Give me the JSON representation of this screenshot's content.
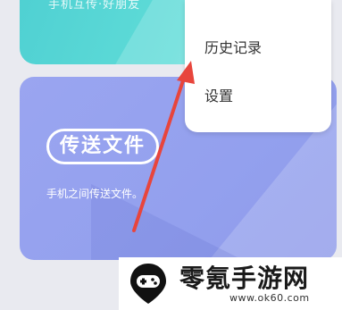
{
  "top_card": {
    "partial_text": "手机互传·好朋友"
  },
  "transfer_card": {
    "title": "传送文件",
    "subtitle": "手机之间传送文件。"
  },
  "menu": {
    "items": [
      {
        "label": "历史记录"
      },
      {
        "label": "设置"
      }
    ]
  },
  "watermark": {
    "brand": "零氪手游网",
    "url": "www.ok60.com"
  },
  "colors": {
    "teal_card": "#4fd0d2",
    "purple_card": "#9aa5f0",
    "arrow": "#e8453c",
    "menu_bg": "#ffffff"
  }
}
